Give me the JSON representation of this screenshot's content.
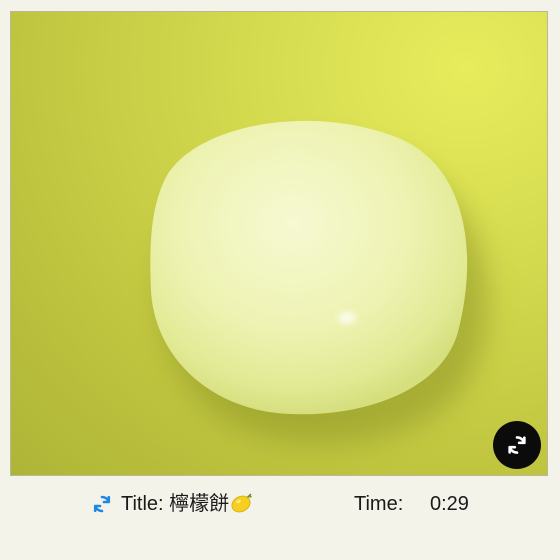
{
  "photo": {
    "subject_icon": "lemon-cake-photo",
    "background_color": "#cfd548",
    "object_color": "#eef3b0"
  },
  "controls": {
    "rotate_icon": "rotate-arrows-icon",
    "refresh_icon": "refresh-icon",
    "accent_color": "#1e88e5"
  },
  "info": {
    "title_label": "Title:",
    "title_value": "檸檬餅",
    "title_emoji_icon": "lemon-icon",
    "time_label": "Time:",
    "time_value": "0:29"
  }
}
